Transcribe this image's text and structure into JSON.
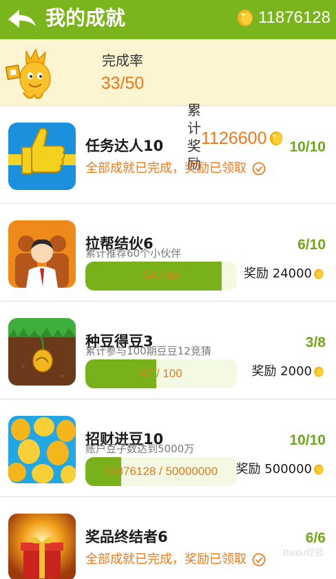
{
  "header": {
    "title": "我的成就",
    "balance": "11876128",
    "back_icon": "arrow-left-icon",
    "coin_icon": "bean-coin-icon"
  },
  "summary": {
    "rate_label": "完成率",
    "rate_value": "33/50",
    "reward_label": "累计奖励",
    "reward_value": "1126600"
  },
  "achievements": [
    {
      "name": "任务达人10",
      "count": "10/10",
      "status": "全部成就已完成，奖励已领取",
      "icon": "thumbs-up-icon"
    },
    {
      "name": "拉帮结伙6",
      "count": "6/10",
      "desc": "累计推荐60个小伙伴",
      "progress_text": "54 / 60",
      "progress": 0.9,
      "reward": "奖励 24000",
      "icon": "group-people-icon"
    },
    {
      "name": "种豆得豆3",
      "count": "3/8",
      "desc": "累计参与100期豆豆12竞猜",
      "progress_text": "47 / 100",
      "progress": 0.47,
      "reward": "奖励 2000",
      "icon": "bean-sprout-icon"
    },
    {
      "name": "招财进豆10",
      "count": "10/10",
      "desc": "账户豆子数达到5000万",
      "progress_text": "11876128 / 50000000",
      "progress": 0.2375,
      "reward": "奖励 500000",
      "icon": "pile-of-beans-icon"
    },
    {
      "name": "奖品终结者6",
      "count": "6/6",
      "status": "全部成就已完成，奖励已领取",
      "icon": "gift-box-icon"
    }
  ],
  "colors": {
    "header_green": "#7ab51d",
    "accent_orange": "#e8781a",
    "count_green": "#6fa61a",
    "summary_bg": "#fdf5d2"
  },
  "watermark": "Baidu经验"
}
